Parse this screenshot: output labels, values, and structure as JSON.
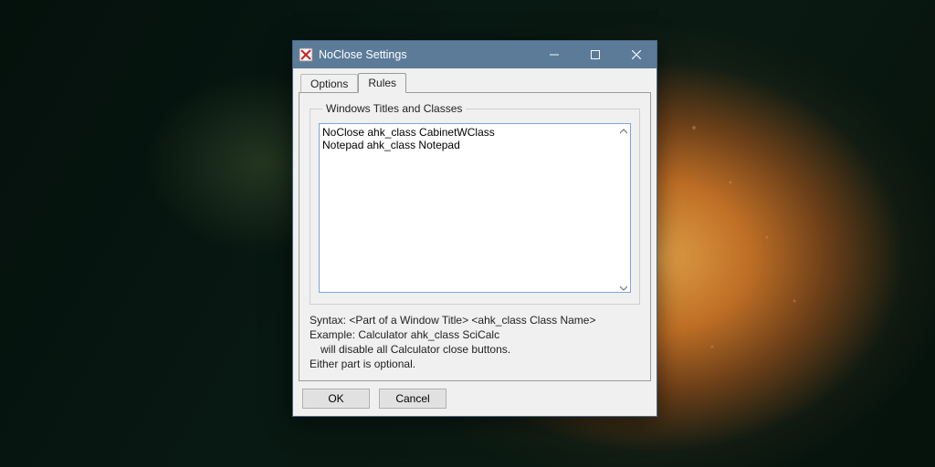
{
  "window": {
    "title": "NoClose Settings"
  },
  "tabs": {
    "options": "Options",
    "rules": "Rules"
  },
  "group": {
    "legend": "Windows Titles and Classes"
  },
  "rules_text": "NoClose ahk_class CabinetWClass\nNotepad ahk_class Notepad",
  "help": {
    "syntax": "Syntax: <Part of a Window Title> <ahk_class Class Name>",
    "example": "Example: Calculator ahk_class SciCalc",
    "example_desc": "will disable all Calculator close buttons.",
    "optional": "Either part is optional."
  },
  "buttons": {
    "ok": "OK",
    "cancel": "Cancel"
  }
}
